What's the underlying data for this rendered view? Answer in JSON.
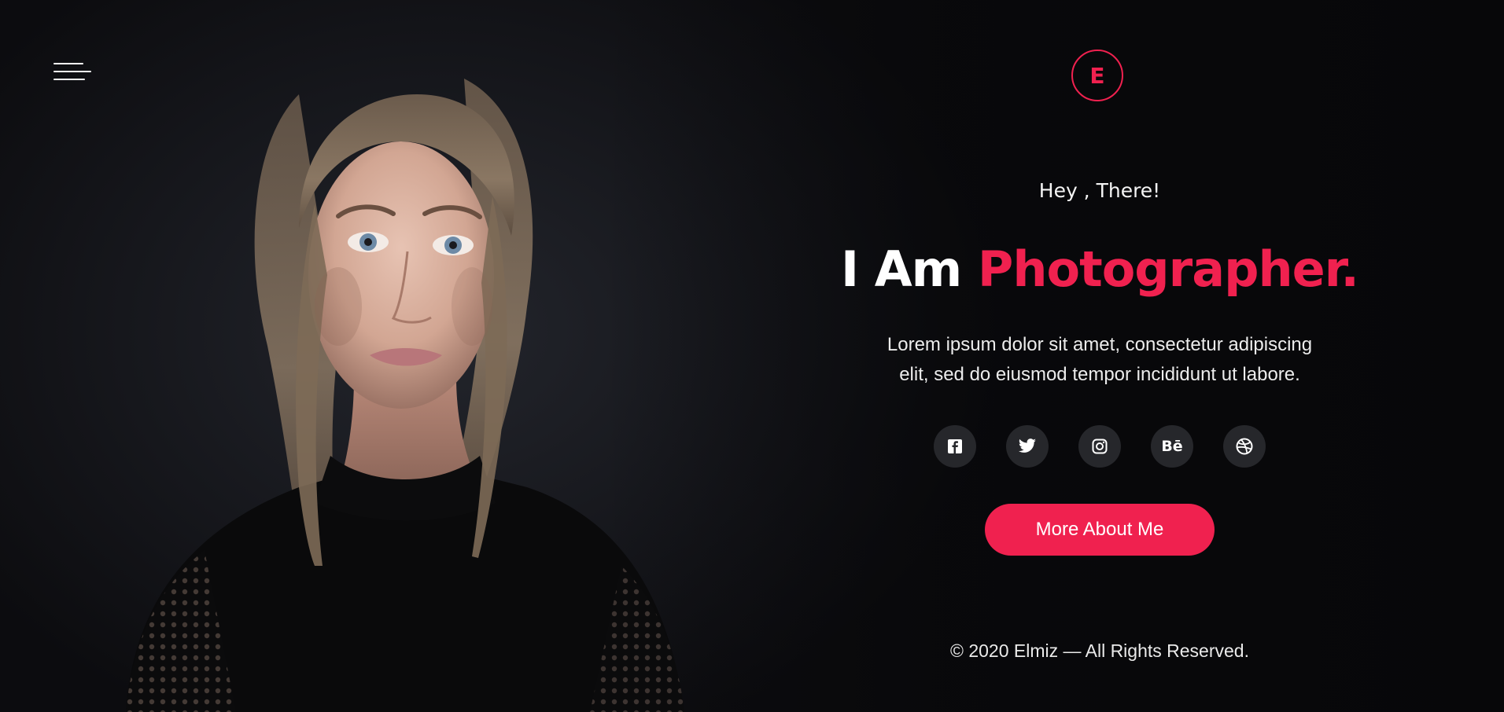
{
  "header": {
    "logo_letter": "E"
  },
  "hero": {
    "greeting": "Hey , There!",
    "headline_prefix": "I Am",
    "headline_accent": "Photographer.",
    "intro_line1": "Lorem ipsum dolor sit amet, consectetur adipiscing",
    "intro_line2": "elit, sed do eiusmod tempor incididunt ut labore.",
    "cta_label": "More About Me"
  },
  "socials": {
    "icons": [
      "facebook-icon",
      "twitter-icon",
      "instagram-icon",
      "behance-icon",
      "dribbble-icon"
    ],
    "behance_text": "Bē"
  },
  "footer": {
    "copyright": "© 2020 Elmiz — All Rights Reserved."
  },
  "colors": {
    "accent": "#f0214f",
    "background": "#0d0d10",
    "social_bg": "#26272b"
  }
}
